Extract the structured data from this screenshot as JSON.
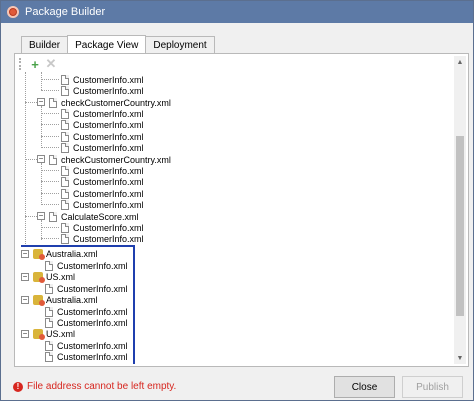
{
  "window": {
    "title": "Package Builder"
  },
  "tabs": [
    {
      "label": "Builder",
      "active": false
    },
    {
      "label": "Package View",
      "active": true
    },
    {
      "label": "Deployment",
      "active": false
    }
  ],
  "toolbar": {
    "add_icon": "plus-icon",
    "delete_icon": "x-icon"
  },
  "tree": {
    "items": [
      {
        "label": "CustomerInfo.xml",
        "kind": "file"
      },
      {
        "label": "CustomerInfo.xml",
        "kind": "file"
      },
      {
        "label": "checkCustomerCountry.xml",
        "kind": "file"
      },
      {
        "label": "CustomerInfo.xml",
        "kind": "file"
      },
      {
        "label": "CustomerInfo.xml",
        "kind": "file"
      },
      {
        "label": "CustomerInfo.xml",
        "kind": "file"
      },
      {
        "label": "CustomerInfo.xml",
        "kind": "file"
      },
      {
        "label": "checkCustomerCountry.xml",
        "kind": "file"
      },
      {
        "label": "CustomerInfo.xml",
        "kind": "file"
      },
      {
        "label": "CustomerInfo.xml",
        "kind": "file"
      },
      {
        "label": "CustomerInfo.xml",
        "kind": "file"
      },
      {
        "label": "CustomerInfo.xml",
        "kind": "file"
      },
      {
        "label": "CalculateScore.xml",
        "kind": "file"
      },
      {
        "label": "CustomerInfo.xml",
        "kind": "file"
      },
      {
        "label": "CustomerInfo.xml",
        "kind": "file"
      },
      {
        "label": "Australia.xml",
        "kind": "warning"
      },
      {
        "label": "CustomerInfo.xml",
        "kind": "file"
      },
      {
        "label": "US.xml",
        "kind": "warning"
      },
      {
        "label": "CustomerInfo.xml",
        "kind": "file"
      },
      {
        "label": "Australia.xml",
        "kind": "warning"
      },
      {
        "label": "CustomerInfo.xml",
        "kind": "file"
      },
      {
        "label": "CustomerInfo.xml",
        "kind": "file"
      },
      {
        "label": "US.xml",
        "kind": "warning"
      },
      {
        "label": "CustomerInfo.xml",
        "kind": "file"
      },
      {
        "label": "CustomerInfo.xml",
        "kind": "file"
      }
    ]
  },
  "status": {
    "error_message": "File address cannot be left empty."
  },
  "buttons": {
    "close": "Close",
    "publish": "Publish"
  },
  "colors": {
    "titlebar": "#5d7aa6",
    "highlight": "#1f3fae",
    "error": "#d7261f"
  }
}
